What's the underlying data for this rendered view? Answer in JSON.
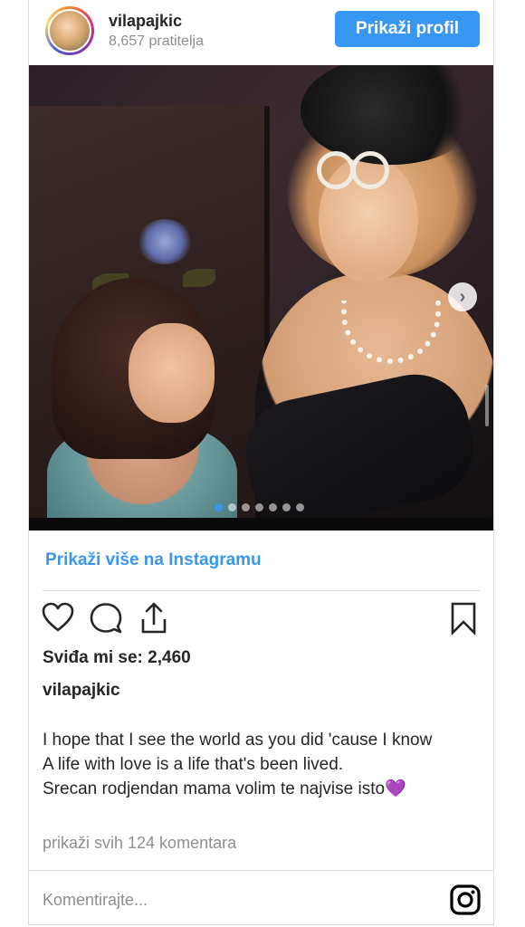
{
  "header": {
    "username": "vilapajkic",
    "followers": "8,657 pratitelja",
    "profile_button": "Prikaži profil"
  },
  "carousel": {
    "slide_count": 7,
    "active_index": 0,
    "next_icon": "chevron-right-icon"
  },
  "more_link": "Prikaži više na Instagramu",
  "actions": {
    "icons": [
      "heart-icon",
      "comment-icon",
      "share-icon",
      "bookmark-icon"
    ]
  },
  "likes": "Sviđa mi se: 2,460",
  "caption": {
    "username": "vilapajkic",
    "line1": "I hope that I see the world as you did 'cause I know",
    "line2": "A life with love is a life that's been lived.",
    "line3": "Srecan rodjendan mama volim te najvise isto💜"
  },
  "view_comments": "prikaži svih 124 komentara",
  "comment": {
    "placeholder": "Komentirajte...",
    "value": ""
  },
  "colors": {
    "accent": "#3897f0",
    "muted_text": "#8e8e8e",
    "border": "#dbdbdb"
  }
}
